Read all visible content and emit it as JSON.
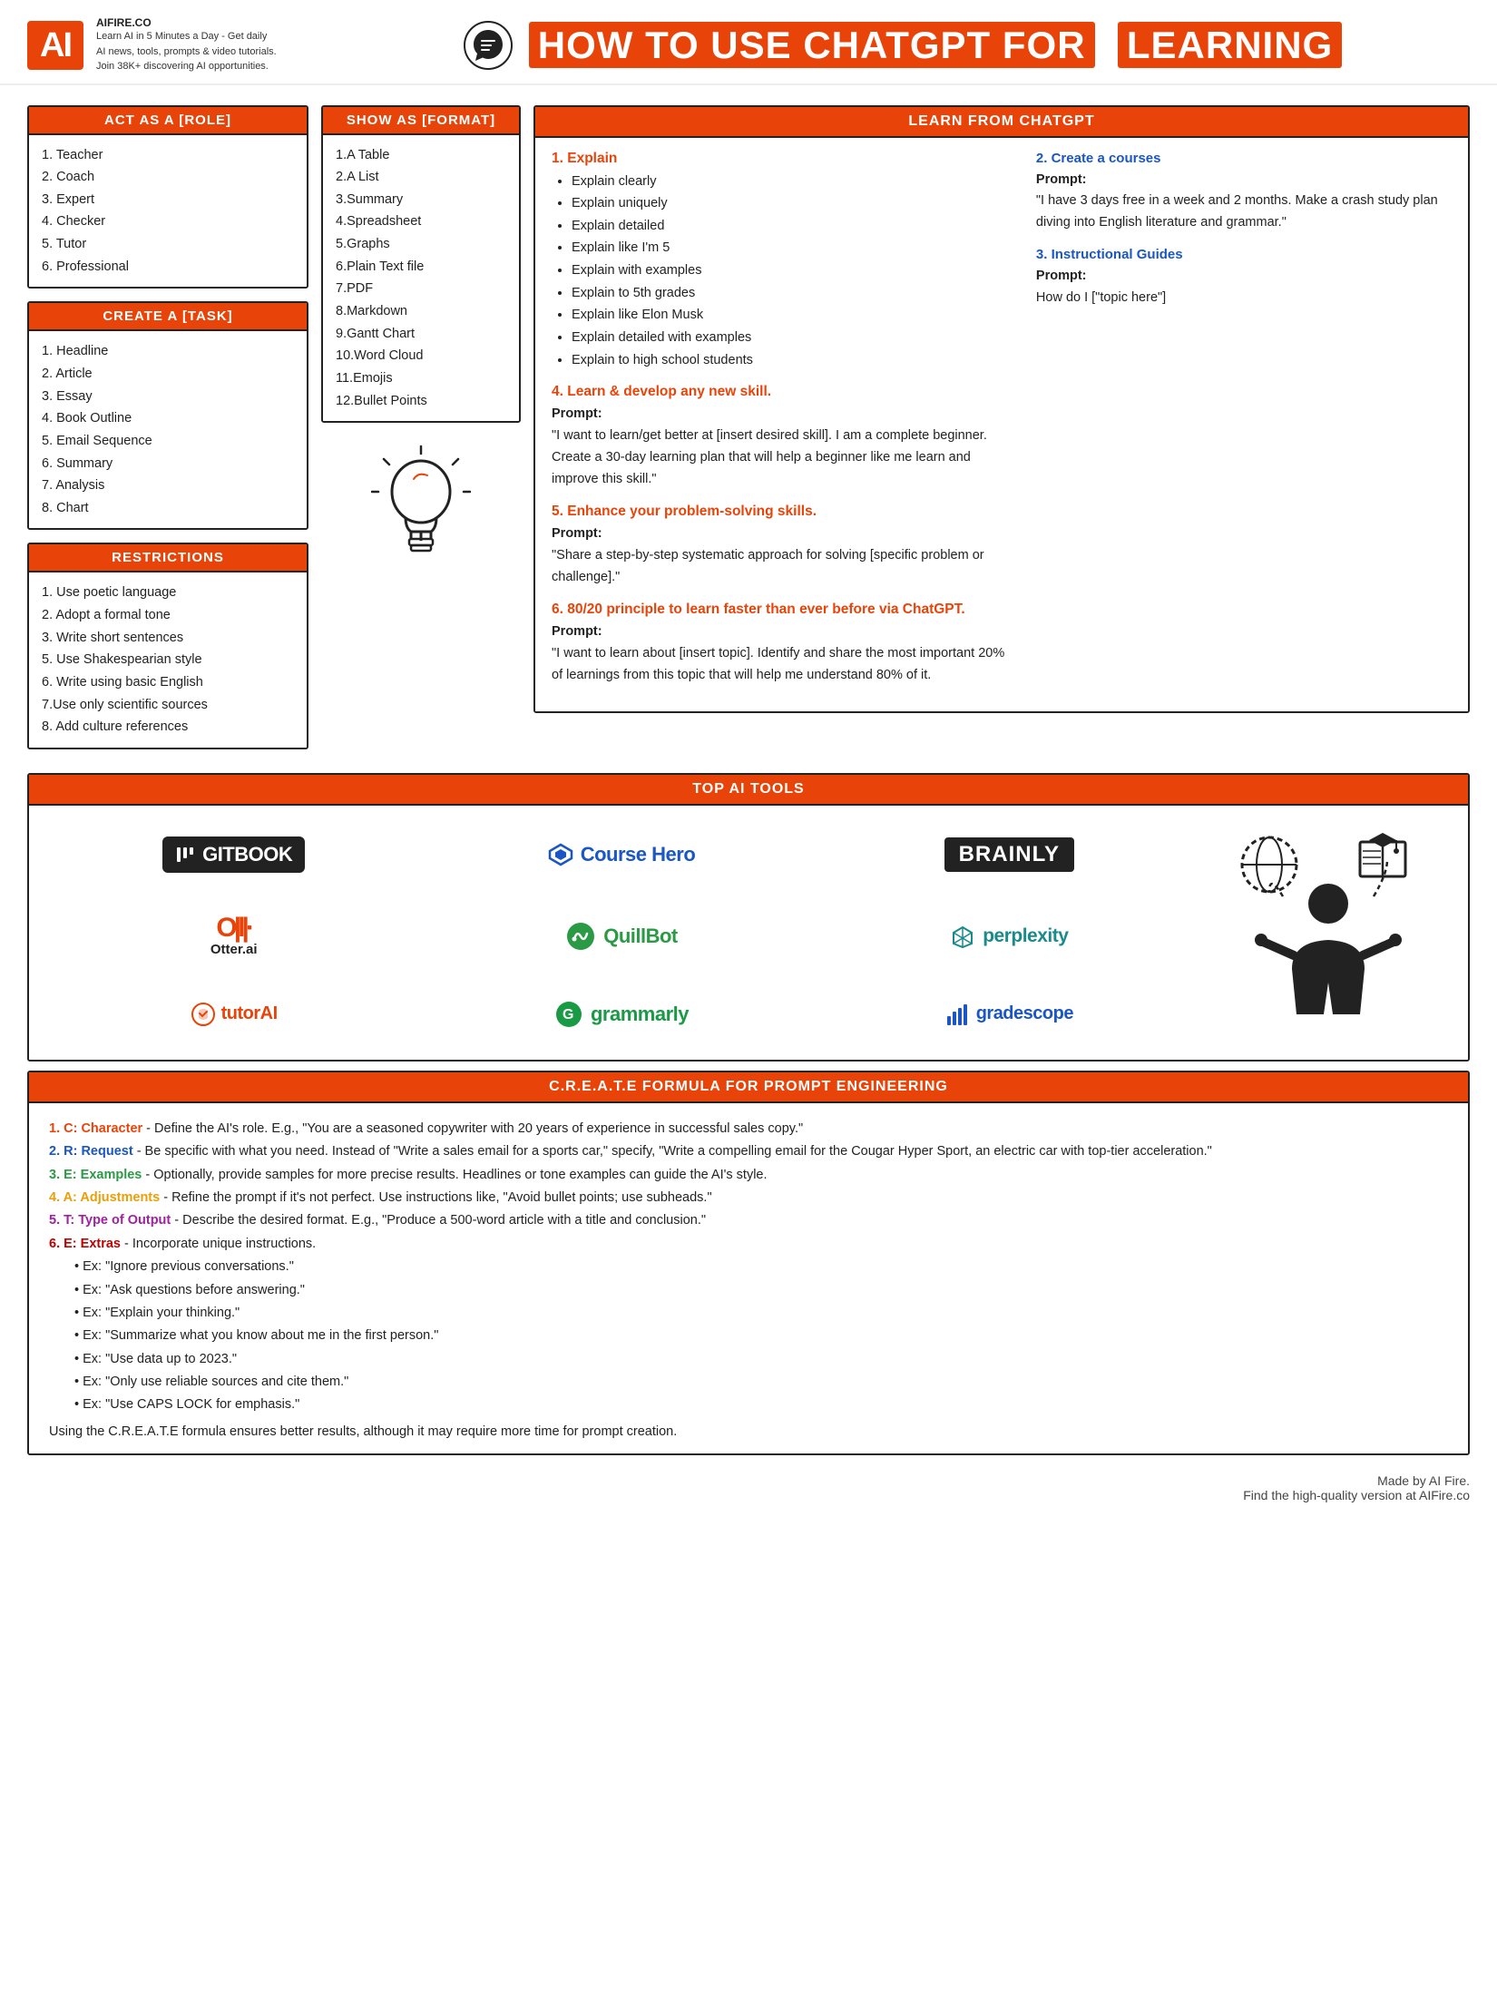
{
  "header": {
    "logo": "AI",
    "site": "AIFIRE.CO",
    "tagline": "Learn AI in 5 Minutes a Day - Get daily AI news, tools, prompts & video tutorials. Join 38K+ discovering AI opportunities.",
    "title_prefix": "HOW TO USE CHATGPT FOR",
    "title_highlight": "LEARNING"
  },
  "act_as_role": {
    "header": "ACT AS A [ROLE]",
    "items": [
      "1. Teacher",
      "2. Coach",
      "3. Expert",
      "4. Checker",
      "5. Tutor",
      "6. Professional"
    ]
  },
  "create_task": {
    "header": "CREATE A [TASK]",
    "items": [
      "1. Headline",
      "2. Article",
      "3. Essay",
      "4. Book Outline",
      "5. Email Sequence",
      "6. Summary",
      "7. Analysis",
      "8. Chart"
    ]
  },
  "restrictions": {
    "header": "RESTRICTIONS",
    "items": [
      "1. Use poetic language",
      "2. Adopt a formal tone",
      "3. Write short sentences",
      "5. Use Shakespearian style",
      "6. Write using basic English",
      "7.Use only scientific sources",
      "8. Add culture references"
    ]
  },
  "show_format": {
    "header": "SHOW AS [FORMAT]",
    "items": [
      "1.A Table",
      "2.A List",
      "3.Summary",
      "4.Spreadsheet",
      "5.Graphs",
      "6.Plain Text file",
      "7.PDF",
      "8.Markdown",
      "9.Gantt Chart",
      "10.Word Cloud",
      "11.Emojis",
      "12.Bullet Points"
    ]
  },
  "learn_from_chatgpt": {
    "header": "LEARN FROM CHATGPT",
    "section1": {
      "title": "1. Explain",
      "items": [
        "Explain clearly",
        "Explain uniquely",
        "Explain detailed",
        "Explain like I'm 5",
        "Explain with examples",
        "Explain to 5th grades",
        "Explain like Elon Musk",
        "Explain detailed with examples",
        "Explain to high school students"
      ]
    },
    "section2": {
      "title": "2. Create a courses",
      "prompt_label": "Prompt:",
      "prompt_text": "\"I have 3 days free in a week and 2 months. Make a crash study plan diving into English literature and grammar.\""
    },
    "section3": {
      "title": "3. Instructional Guides",
      "prompt_label": "Prompt:",
      "prompt_text": "How do I [\"topic here\"]"
    },
    "section4": {
      "title": "4. Learn & develop any new skill.",
      "prompt_label": "Prompt:",
      "prompt_text": "\"I want to learn/get better at [insert desired skill]. I am a complete beginner. Create a 30-day learning plan that will help a beginner like me learn and improve this skill.\""
    },
    "section5": {
      "title": "5. Enhance your problem-solving skills.",
      "prompt_label": "Prompt:",
      "prompt_text": "\"Share a step-by-step systematic approach for solving [specific problem or challenge].\""
    },
    "section6": {
      "title": "6. 80/20 principle to learn faster than ever before via ChatGPT.",
      "prompt_label": "Prompt:",
      "prompt_text": "\"I want to learn about [insert topic]. Identify and share the most important 20% of learnings from this topic that will help me understand 80% of it."
    }
  },
  "top_ai_tools": {
    "header": "TOP AI TOOLS",
    "tools": [
      {
        "name": "GitBook",
        "label": "GITBOOK"
      },
      {
        "name": "Course Hero",
        "label": "Course Hero"
      },
      {
        "name": "Brainly",
        "label": "BRAINLY"
      },
      {
        "name": "Otter.ai",
        "label": "Otter.ai"
      },
      {
        "name": "QuillBot",
        "label": "QuillBot"
      },
      {
        "name": "perplexity",
        "label": "perplexity"
      },
      {
        "name": "tutorAI",
        "label": "tutorAI"
      },
      {
        "name": "grammarly",
        "label": "grammarly"
      },
      {
        "name": "gradescope",
        "label": "gradescope"
      }
    ]
  },
  "create_formula": {
    "header": "C.R.E.A.T.E FORMULA FOR PROMPT ENGINEERING",
    "items": [
      {
        "key": "1. C: Character",
        "text": " - Define the AI's role. E.g., \"You are a seasoned copywriter with 20 years of experience in successful sales copy.\""
      },
      {
        "key": "2. R: Request",
        "text": " - Be specific with what you need. Instead of \"Write a sales email for a sports car,\" specify, \"Write a compelling email for the Cougar Hyper Sport, an electric car with top-tier acceleration.\""
      },
      {
        "key": "3. E: Examples",
        "text": " - Optionally, provide samples for more precise results. Headlines or tone examples can guide the AI's style."
      },
      {
        "key": "4. A: Adjustments",
        "text": " - Refine the prompt if it's not perfect. Use instructions like, \"Avoid bullet points; use subheads.\""
      },
      {
        "key": "5. T: Type of Output",
        "text": " - Describe the desired format. E.g., \"Produce a 500-word article with a title and conclusion.\""
      },
      {
        "key": "6. E: Extras",
        "text": " - Incorporate unique instructions."
      }
    ],
    "extras": [
      "Ex: \"Ignore previous conversations.\"",
      "Ex: \"Ask questions before answering.\"",
      "Ex: \"Explain your thinking.\"",
      "Ex: \"Summarize what you know about me in the first person.\"",
      "Ex: \"Use data up to 2023.\"",
      "Ex: \"Only use reliable sources and cite them.\"",
      "Ex: \"Use CAPS LOCK for emphasis.\""
    ],
    "note": "Using the C.R.E.A.T.E formula ensures better results, although it may require more time for prompt creation."
  },
  "footer": {
    "line1": "Made by AI Fire.",
    "line2": "Find the high-quality version at AIFire.co"
  }
}
